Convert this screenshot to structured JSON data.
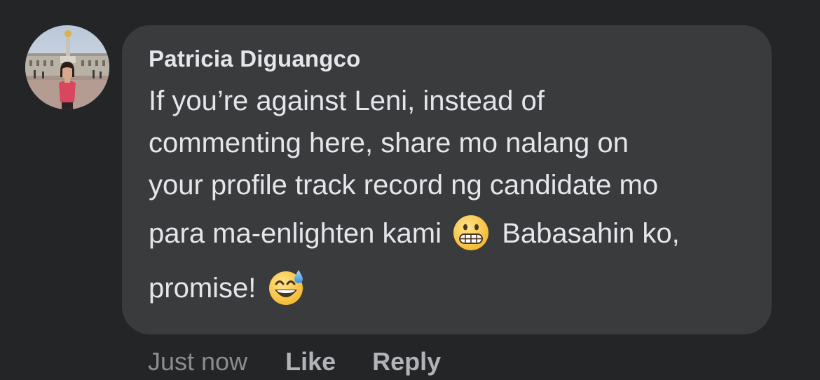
{
  "comment": {
    "author": "Patricia Diguangco",
    "lines": [
      "If you’re against Leni, instead of",
      "commenting here, share mo nalang on",
      "your profile track record ng candidate mo"
    ],
    "line4_before": "para ma-enlighten kami",
    "line4_after": "Babasahin ko,",
    "line5_before": "promise!",
    "emoji_1": "grimacing-face-emoji",
    "emoji_2": "grinning-face-with-sweat-emoji"
  },
  "actions": {
    "timestamp": "Just now",
    "like_label": "Like",
    "reply_label": "Reply"
  },
  "colors": {
    "background": "#242526",
    "bubble": "#3a3b3c",
    "text": "#e4e6eb",
    "secondary_text": "#b0b3b8"
  }
}
